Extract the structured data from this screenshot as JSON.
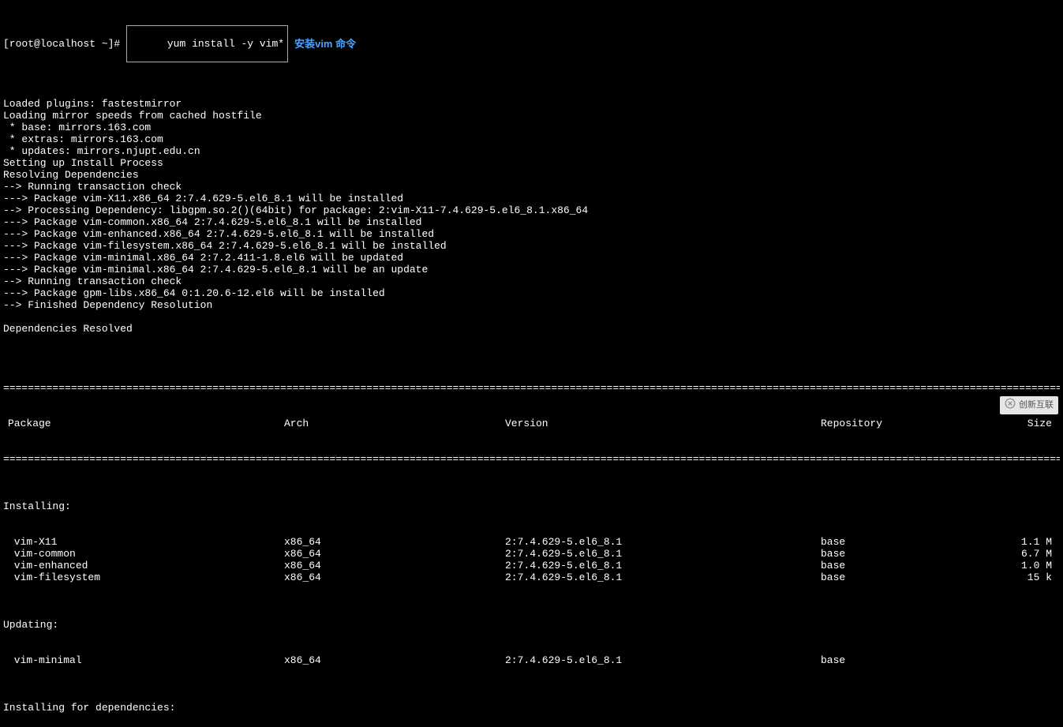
{
  "prompt": {
    "user_host": "[root@localhost ~]#",
    "command": "yum install -y vim*",
    "annotation": "安装vim 命令"
  },
  "output_lines": [
    "Loaded plugins: fastestmirror",
    "Loading mirror speeds from cached hostfile",
    " * base: mirrors.163.com",
    " * extras: mirrors.163.com",
    " * updates: mirrors.njupt.edu.cn",
    "Setting up Install Process",
    "Resolving Dependencies",
    "--> Running transaction check",
    "---> Package vim-X11.x86_64 2:7.4.629-5.el6_8.1 will be installed",
    "--> Processing Dependency: libgpm.so.2()(64bit) for package: 2:vim-X11-7.4.629-5.el6_8.1.x86_64",
    "---> Package vim-common.x86_64 2:7.4.629-5.el6_8.1 will be installed",
    "---> Package vim-enhanced.x86_64 2:7.4.629-5.el6_8.1 will be installed",
    "---> Package vim-filesystem.x86_64 2:7.4.629-5.el6_8.1 will be installed",
    "---> Package vim-minimal.x86_64 2:7.2.411-1.8.el6 will be updated",
    "---> Package vim-minimal.x86_64 2:7.4.629-5.el6_8.1 will be an update",
    "--> Running transaction check",
    "---> Package gpm-libs.x86_64 0:1.20.6-12.el6 will be installed",
    "--> Finished Dependency Resolution",
    "",
    "Dependencies Resolved",
    ""
  ],
  "table": {
    "headers": {
      "package": "Package",
      "arch": "Arch",
      "version": "Version",
      "repo": "Repository",
      "size": "Size"
    },
    "sections": {
      "installing": "Installing:",
      "updating": "Updating:",
      "installing_deps": "Installing for dependencies:"
    },
    "installing_rows": [
      {
        "pkg": " vim-X11",
        "arch": "x86_64",
        "ver": "2:7.4.629-5.el6_8.1",
        "repo": "base",
        "size": "1.1 M"
      },
      {
        "pkg": " vim-common",
        "arch": "x86_64",
        "ver": "2:7.4.629-5.el6_8.1",
        "repo": "base",
        "size": "6.7 M"
      },
      {
        "pkg": " vim-enhanced",
        "arch": "x86_64",
        "ver": "2:7.4.629-5.el6_8.1",
        "repo": "base",
        "size": "1.0 M"
      },
      {
        "pkg": " vim-filesystem",
        "arch": "x86_64",
        "ver": "2:7.4.629-5.el6_8.1",
        "repo": "base",
        "size": "15 k"
      }
    ],
    "updating_rows": [
      {
        "pkg": " vim-minimal",
        "arch": "x86_64",
        "ver": "2:7.4.629-5.el6_8.1",
        "repo": "base",
        "size": ""
      }
    ]
  },
  "watermark": "创新互联"
}
